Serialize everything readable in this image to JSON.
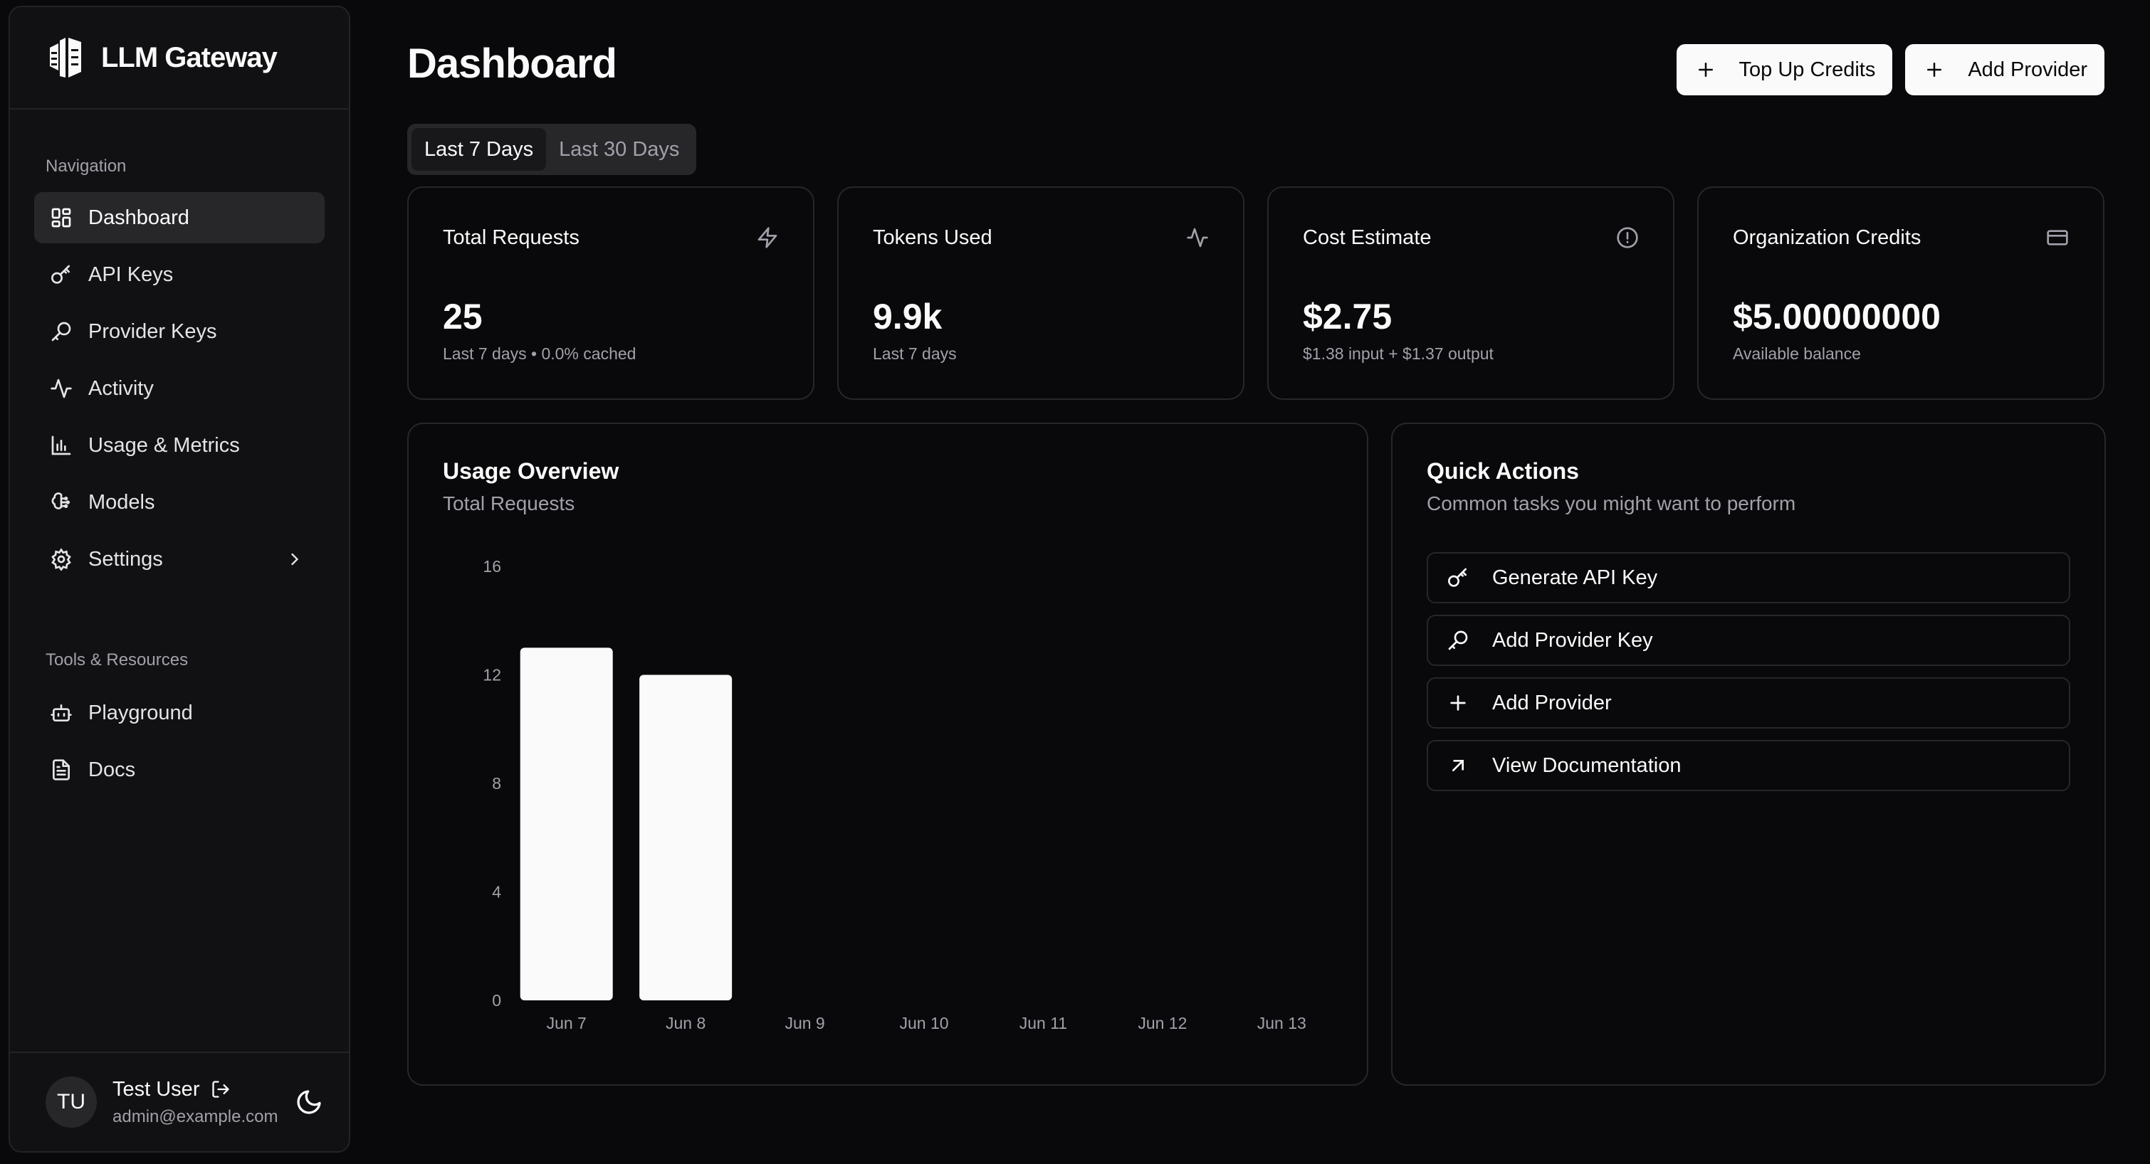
{
  "sidebar": {
    "brand": "LLM Gateway",
    "nav_label": "Navigation",
    "nav_items": [
      {
        "label": "Dashboard",
        "icon": "grid-icon"
      },
      {
        "label": "API Keys",
        "icon": "key-icon"
      },
      {
        "label": "Provider Keys",
        "icon": "key-round-icon"
      },
      {
        "label": "Activity",
        "icon": "activity-icon"
      },
      {
        "label": "Usage & Metrics",
        "icon": "bar-chart-icon"
      },
      {
        "label": "Models",
        "icon": "brain-icon"
      },
      {
        "label": "Settings",
        "icon": "gear-icon"
      }
    ],
    "tools_label": "Tools & Resources",
    "tool_items": [
      {
        "label": "Playground",
        "icon": "bot-icon"
      },
      {
        "label": "Docs",
        "icon": "document-icon"
      }
    ],
    "user": {
      "initials": "TU",
      "name": "Test User",
      "email": "admin@example.com"
    }
  },
  "header": {
    "title": "Dashboard",
    "top_up_label": "Top Up Credits",
    "add_provider_label": "Add Provider"
  },
  "range_tabs": [
    "Last 7 Days",
    "Last 30 Days"
  ],
  "stats": [
    {
      "title": "Total Requests",
      "value": "25",
      "sub": "Last 7 days • 0.0% cached",
      "icon": "zap-icon"
    },
    {
      "title": "Tokens Used",
      "value": "9.9k",
      "sub": "Last 7 days",
      "icon": "activity-icon"
    },
    {
      "title": "Cost Estimate",
      "value": "$2.75",
      "sub": "$1.38 input + $1.37 output",
      "icon": "info-circle-icon"
    },
    {
      "title": "Organization Credits",
      "value": "$5.00000000",
      "sub": "Available balance",
      "icon": "credit-card-icon"
    }
  ],
  "usage": {
    "title": "Usage Overview",
    "subtitle": "Total Requests"
  },
  "chart_data": {
    "type": "bar",
    "categories": [
      "Jun 7",
      "Jun 8",
      "Jun 9",
      "Jun 10",
      "Jun 11",
      "Jun 12",
      "Jun 13"
    ],
    "values": [
      13,
      12,
      0,
      0,
      0,
      0,
      0
    ],
    "yticks": [
      0,
      4,
      8,
      12,
      16
    ],
    "ylim": [
      0,
      16
    ],
    "color": "#fafafa",
    "grid": false
  },
  "quick_actions": {
    "title": "Quick Actions",
    "subtitle": "Common tasks you might want to perform",
    "items": [
      {
        "label": "Generate API Key",
        "icon": "key-icon"
      },
      {
        "label": "Add Provider Key",
        "icon": "key-round-icon"
      },
      {
        "label": "Add Provider",
        "icon": "plus-icon"
      },
      {
        "label": "View Documentation",
        "icon": "arrow-up-right-icon"
      }
    ]
  }
}
